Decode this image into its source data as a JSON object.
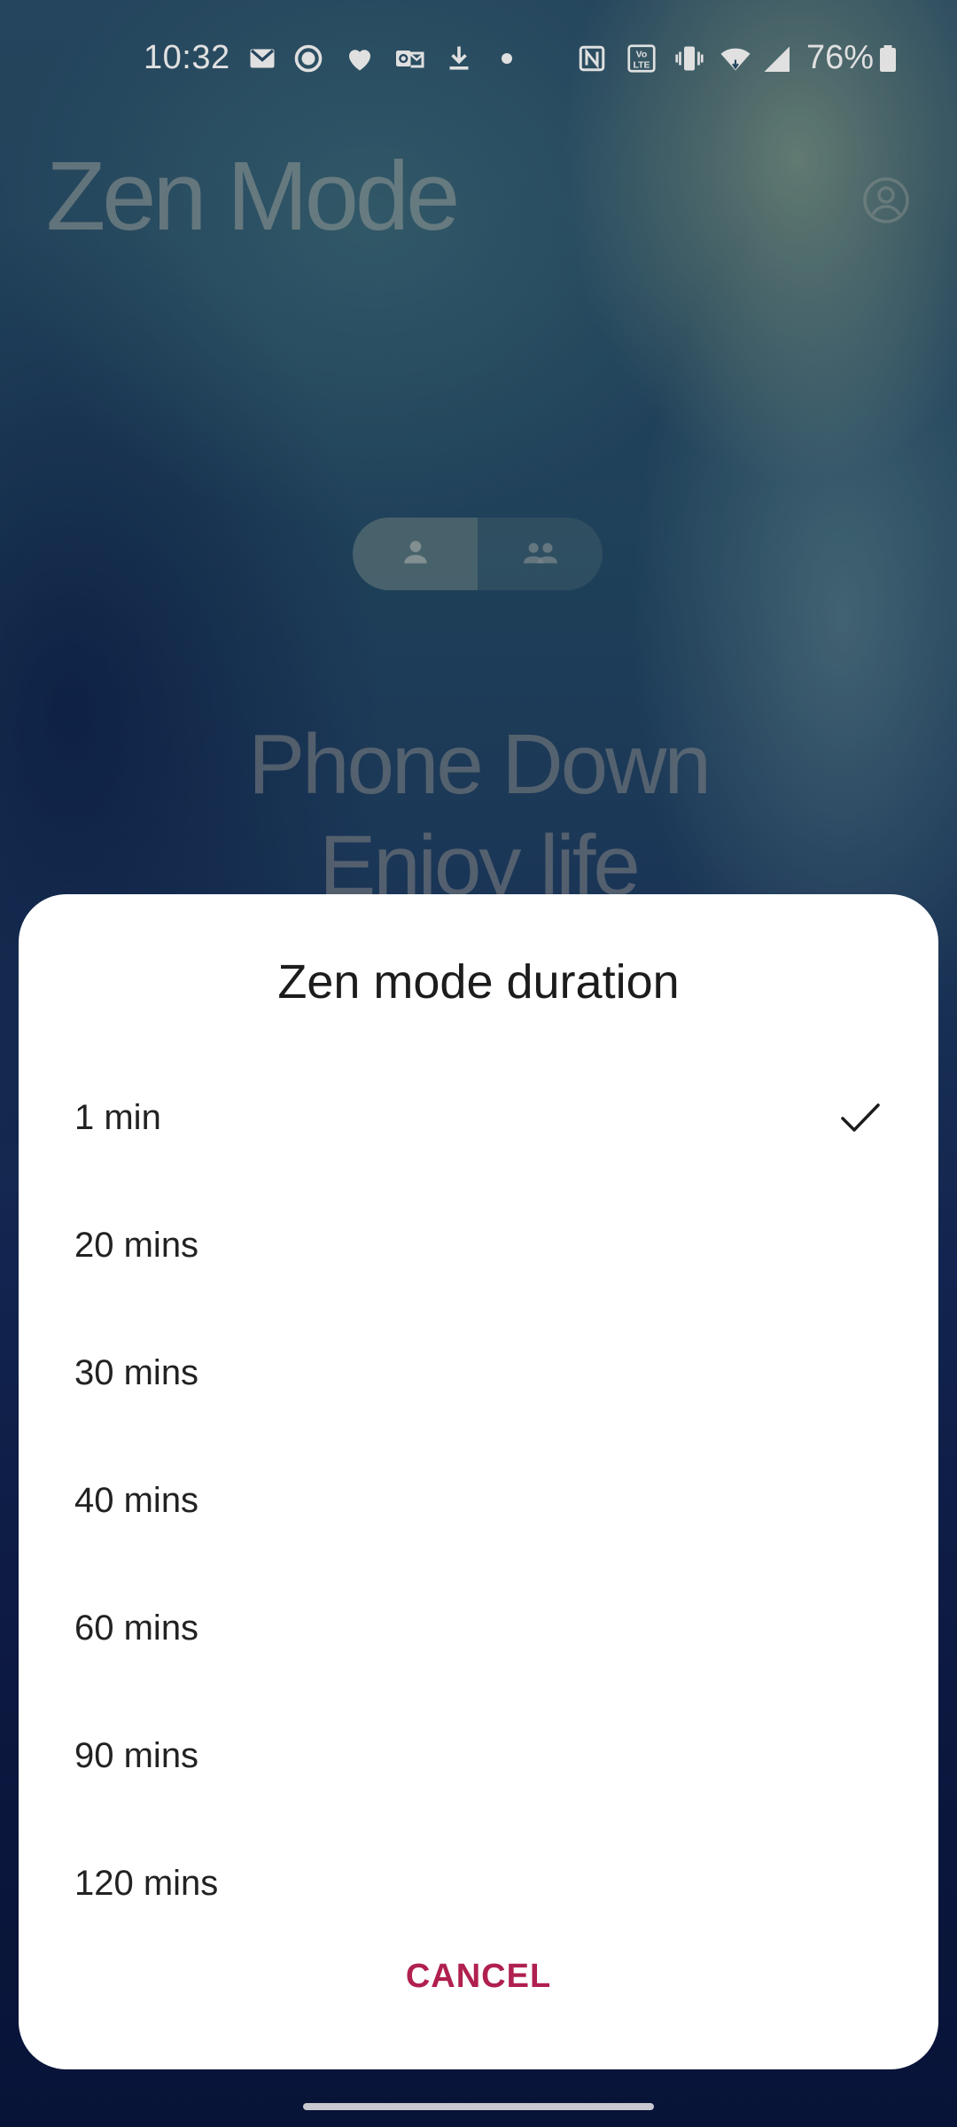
{
  "status_bar": {
    "time": "10:32",
    "battery": "76%",
    "icons": [
      "gmail-icon",
      "record-icon",
      "heart-icon",
      "outlook-icon",
      "download-icon",
      "dot-icon",
      "nfc-icon",
      "volte-icon",
      "vibrate-icon",
      "wifi-icon",
      "signal-icon",
      "battery-icon"
    ]
  },
  "header": {
    "title": "Zen Mode",
    "account_icon": "account-circle-icon"
  },
  "segment": {
    "items": [
      {
        "icon": "person-icon",
        "active": true
      },
      {
        "icon": "group-icon",
        "active": false
      }
    ]
  },
  "hero": {
    "line1": "Phone Down",
    "line2": "Enjoy life"
  },
  "dialog": {
    "title": "Zen mode duration",
    "options": [
      {
        "label": "1 min",
        "selected": true
      },
      {
        "label": "20 mins",
        "selected": false
      },
      {
        "label": "30 mins",
        "selected": false
      },
      {
        "label": "40 mins",
        "selected": false
      },
      {
        "label": "60 mins",
        "selected": false
      },
      {
        "label": "90 mins",
        "selected": false
      },
      {
        "label": "120 mins",
        "selected": false
      }
    ],
    "cancel_label": "CANCEL",
    "accent_color": "#b0204e"
  }
}
